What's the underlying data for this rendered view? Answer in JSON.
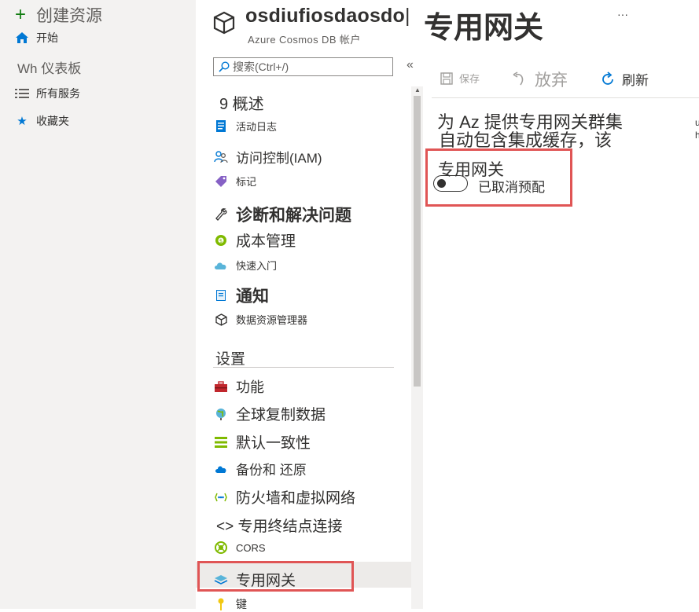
{
  "nav": {
    "create": "创建资源",
    "home": "开始",
    "dashboard": "Wh 仪表板",
    "all_services": "所有服务",
    "favorites": "收藏夹"
  },
  "header": {
    "resource_name": "osdiufiosdaosdo",
    "separator": "|",
    "page_title": "专用网关",
    "resource_type": "Azure Cosmos DB 帐户",
    "more": "···"
  },
  "menu": {
    "search_placeholder": "搜索(Ctrl+/)",
    "collapse": "«",
    "items": [
      {
        "label": "9 概述"
      },
      {
        "label": "活动日志"
      },
      {
        "label": "访问控制(IAM)"
      },
      {
        "label": "标记"
      },
      {
        "label": "诊断和解决问题"
      },
      {
        "label": "成本管理"
      },
      {
        "label": "快速入门"
      },
      {
        "label": "通知"
      },
      {
        "label": "数据资源管理器"
      }
    ],
    "section_settings": "设置",
    "settings_items": [
      {
        "label": "功能"
      },
      {
        "label": "全球复制数据"
      },
      {
        "label": "默认一致性"
      },
      {
        "label": "备份和 还原"
      },
      {
        "label": "防火墙和虚拟网络"
      },
      {
        "label": "<> 专用终结点连接"
      },
      {
        "label": "CORS"
      },
      {
        "label": "专用网关"
      },
      {
        "label": "键"
      }
    ]
  },
  "toolbar": {
    "save": "保存",
    "discard": "放弃",
    "refresh": "刷新"
  },
  "content": {
    "desc_line1": "为 Az 提供专用网关群集",
    "desc_line2": "自动包含集成缓存，该",
    "side_fragment": "u\nh",
    "field_label": "专用网关",
    "toggle_state": "已取消预配",
    "toggle_on": false
  },
  "colors": {
    "accent": "#0078d4",
    "highlight": "#e05555",
    "nav_bg": "#f3f2f1"
  }
}
